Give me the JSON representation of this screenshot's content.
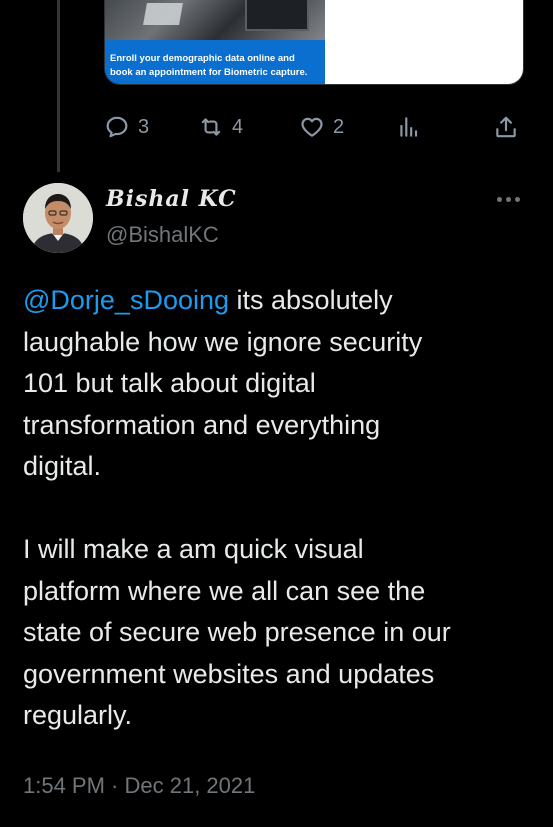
{
  "parent_tweet": {
    "card": {
      "caption_line1": "Enroll your demographic data online and",
      "caption_line2": "book an appointment for Biometric capture."
    },
    "actions": {
      "reply_count": "3",
      "retweet_count": "4",
      "like_count": "2"
    }
  },
  "tweet": {
    "display_name": "Bishal KC",
    "handle": "@BishalKC",
    "mention": "@Dorje_sDooing",
    "paragraph1_line1_rest": " its absolutely",
    "paragraph1_line2": "laughable how we ignore security",
    "paragraph1_line3": "101 but talk about digital",
    "paragraph1_line4": "transformation and everything",
    "paragraph1_line5": "digital.",
    "paragraph2_line1": "I will make a am quick visual",
    "paragraph2_line2": "platform where we all can see the",
    "paragraph2_line3": "state of secure web presence in our",
    "paragraph2_line4": "government websites and updates",
    "paragraph2_line5": "regularly.",
    "timestamp": "1:54 PM · Dec 21, 2021"
  },
  "colors": {
    "background": "#000000",
    "text": "#e7e9ea",
    "muted": "#71767b",
    "link": "#1d9bf0",
    "card_blue": "#0b6fd0"
  },
  "icons": [
    "reply-icon",
    "retweet-icon",
    "like-icon",
    "views-icon",
    "share-icon",
    "more-icon"
  ]
}
